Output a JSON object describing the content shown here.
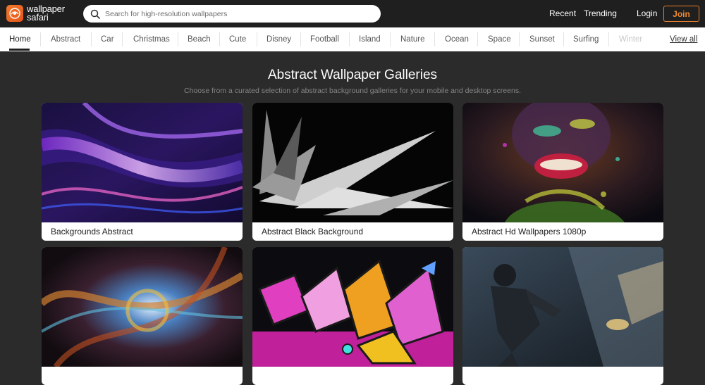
{
  "brand": {
    "line1": "wallpaper",
    "line2": "safari"
  },
  "search": {
    "placeholder": "Search for high-resolution wallpapers"
  },
  "topnav": {
    "recent": "Recent",
    "trending": "Trending",
    "login": "Login",
    "join": "Join"
  },
  "categories": [
    "Home",
    "Abstract",
    "Car",
    "Christmas",
    "Beach",
    "Cute",
    "Disney",
    "Football",
    "Island",
    "Nature",
    "Ocean",
    "Space",
    "Sunset",
    "Surfing",
    "Winter"
  ],
  "active_category": "Home",
  "view_all": "View all",
  "heading": {
    "title": "Abstract Wallpaper Galleries",
    "subtitle": "Choose from a curated selection of abstract background galleries for your mobile and desktop screens."
  },
  "galleries": [
    {
      "caption": "Backgrounds Abstract"
    },
    {
      "caption": "Abstract Black Background"
    },
    {
      "caption": "Abstract Hd Wallpapers 1080p"
    },
    {
      "caption": ""
    },
    {
      "caption": ""
    },
    {
      "caption": ""
    }
  ],
  "colors": {
    "accent": "#f08a2e",
    "topbar": "#1f1f1f",
    "background": "#2b2b2b"
  }
}
